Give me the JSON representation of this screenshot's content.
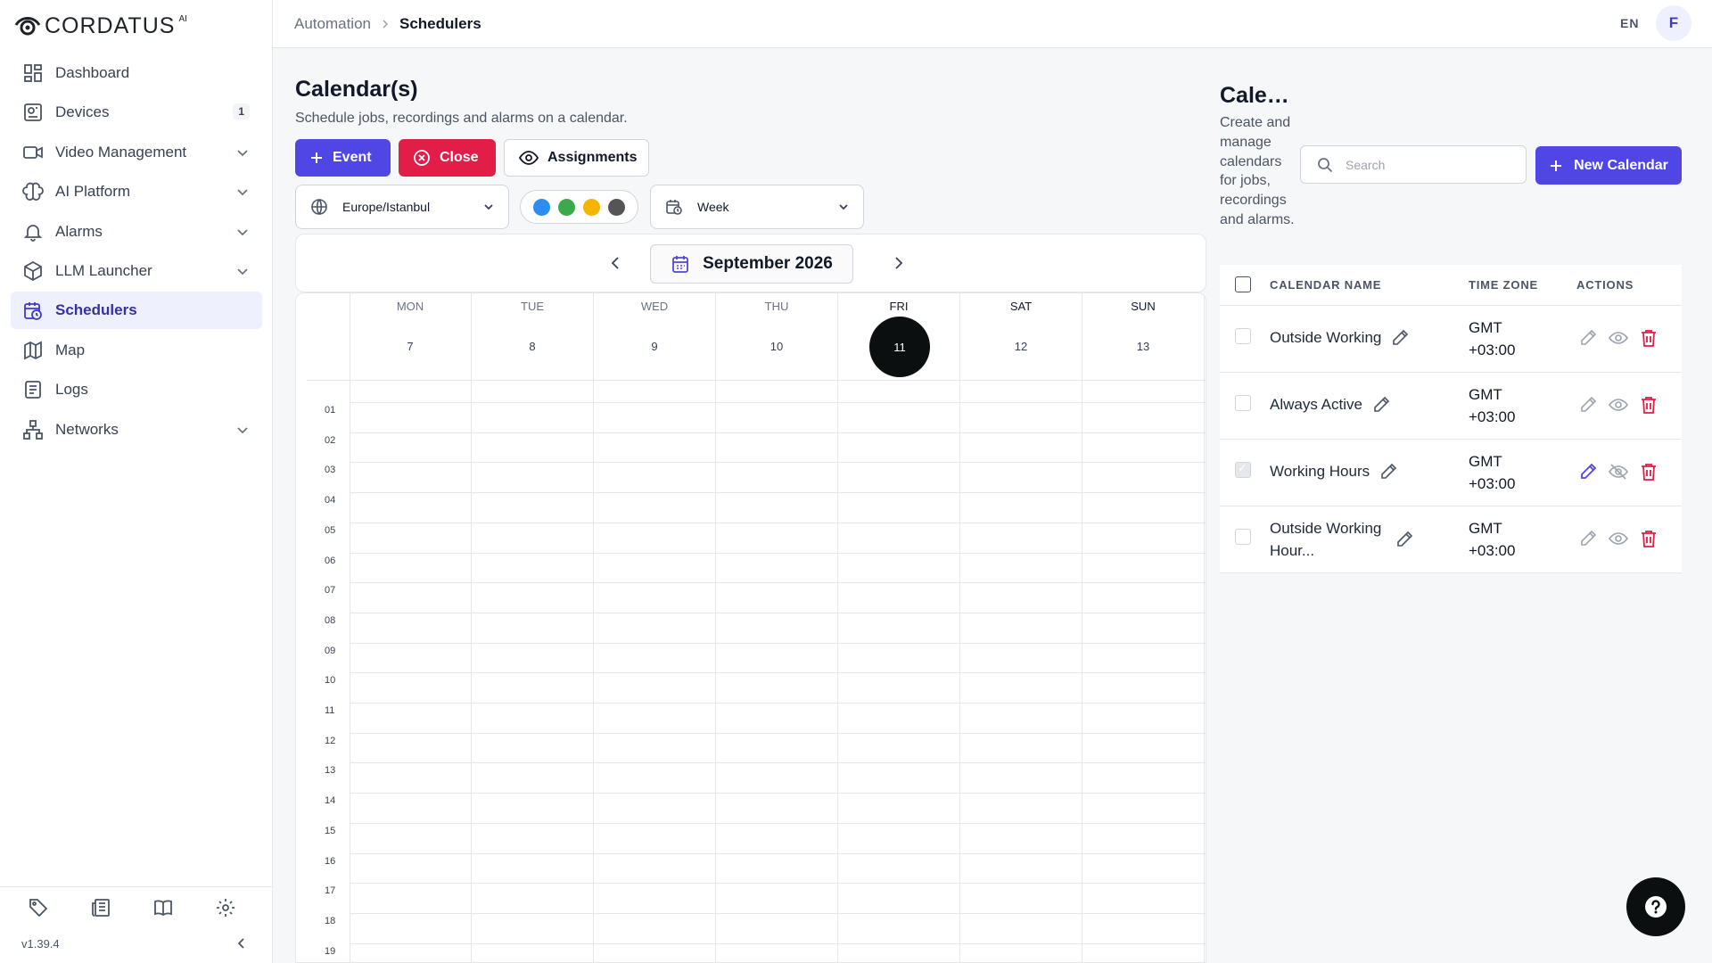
{
  "app": {
    "logo_text": "CORDATUS",
    "logo_sup": "AI",
    "version": "v1.39.4"
  },
  "sidebar": {
    "items": [
      {
        "label": "Dashboard",
        "icon": "dashboard-icon"
      },
      {
        "label": "Devices",
        "icon": "devices-icon",
        "badge": "1"
      },
      {
        "label": "Video Management",
        "icon": "video-icon",
        "expandable": true
      },
      {
        "label": "AI Platform",
        "icon": "brain-icon",
        "expandable": true
      },
      {
        "label": "Alarms",
        "icon": "bell-icon",
        "expandable": true
      },
      {
        "label": "LLM Launcher",
        "icon": "cube-icon",
        "expandable": true
      },
      {
        "label": "Schedulers",
        "icon": "calendar-clock-icon",
        "active": true
      },
      {
        "label": "Map",
        "icon": "map-icon"
      },
      {
        "label": "Logs",
        "icon": "logs-icon"
      },
      {
        "label": "Networks",
        "icon": "network-icon",
        "expandable": true
      }
    ],
    "footer_icons": [
      "tag-icon",
      "news-icon",
      "book-icon",
      "gear-icon"
    ]
  },
  "topbar": {
    "breadcrumb_parent": "Automation",
    "breadcrumb_current": "Schedulers",
    "lang": "EN",
    "avatar": "F"
  },
  "calendar": {
    "title": "Calendar(s)",
    "subtitle": "Schedule jobs, recordings and alarms on a calendar.",
    "event_button": "Event",
    "close_button": "Close",
    "assignments_button": "Assignments",
    "timezone": "Europe/Istanbul",
    "view": "Week",
    "color_dots": [
      "#2b8df0",
      "#3caa4b",
      "#f4b400",
      "#555555"
    ],
    "month_label": "September 2026",
    "days": [
      {
        "name": "MON",
        "num": "7"
      },
      {
        "name": "TUE",
        "num": "8"
      },
      {
        "name": "WED",
        "num": "9"
      },
      {
        "name": "THU",
        "num": "10"
      },
      {
        "name": "FRI",
        "num": "11",
        "today": true
      },
      {
        "name": "SAT",
        "num": "12"
      },
      {
        "name": "SUN",
        "num": "13"
      }
    ],
    "hours": [
      "01",
      "02",
      "03",
      "04",
      "05",
      "06",
      "07",
      "08",
      "09",
      "10",
      "11",
      "12",
      "13",
      "14",
      "15",
      "16",
      "17",
      "18",
      "19"
    ]
  },
  "calendars_panel": {
    "title": "Cale…",
    "description": "Create and manage calendars for jobs, recordings and alarms.",
    "search_placeholder": "Search",
    "new_button": "New Calendar",
    "columns": {
      "name": "CALENDAR NAME",
      "tz": "TIME ZONE",
      "actions": "ACTIONS"
    },
    "rows": [
      {
        "name": "Outside Working",
        "tz_line1": "GMT",
        "tz_line2": "+03:00",
        "selected": false
      },
      {
        "name": "Always Active",
        "tz_line1": "GMT",
        "tz_line2": "+03:00",
        "selected": false
      },
      {
        "name": "Working Hours",
        "tz_line1": "GMT",
        "tz_line2": "+03:00",
        "selected": true
      },
      {
        "name": "Outside Working Hour...",
        "tz_line1": "GMT",
        "tz_line2": "+03:00",
        "selected": false
      }
    ]
  },
  "colors": {
    "accent": "#4f46e5",
    "danger": "#e11d48",
    "today": "#0b0f0f"
  }
}
